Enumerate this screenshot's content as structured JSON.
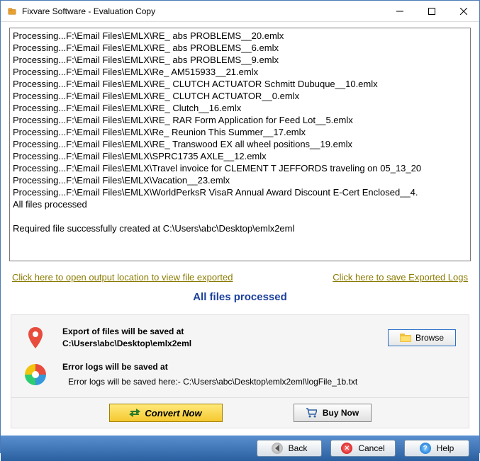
{
  "window": {
    "title": "Fixvare Software - Evaluation Copy"
  },
  "log": {
    "lines": [
      "Processing...F:\\Email Files\\EMLX\\RE_ abs PROBLEMS__20.emlx",
      "Processing...F:\\Email Files\\EMLX\\RE_ abs PROBLEMS__6.emlx",
      "Processing...F:\\Email Files\\EMLX\\RE_ abs PROBLEMS__9.emlx",
      "Processing...F:\\Email Files\\EMLX\\Re_ AM515933__21.emlx",
      "Processing...F:\\Email Files\\EMLX\\RE_ CLUTCH ACTUATOR Schmitt Dubuque__10.emlx",
      "Processing...F:\\Email Files\\EMLX\\RE_ CLUTCH ACTUATOR__0.emlx",
      "Processing...F:\\Email Files\\EMLX\\RE_ Clutch__16.emlx",
      "Processing...F:\\Email Files\\EMLX\\RE_ RAR Form Application for Feed Lot__5.emlx",
      "Processing...F:\\Email Files\\EMLX\\Re_ Reunion This Summer__17.emlx",
      "Processing...F:\\Email Files\\EMLX\\RE_ Transwood EX all wheel positions__19.emlx",
      "Processing...F:\\Email Files\\EMLX\\SPRC1735 AXLE__12.emlx",
      "Processing...F:\\Email Files\\EMLX\\Travel invoice for CLEMENT T JEFFORDS traveling on 05_13_20",
      "Processing...F:\\Email Files\\EMLX\\Vacation__23.emlx",
      "Processing...F:\\Email Files\\EMLX\\WorldPerksR VisaR Annual Award Discount E-Cert Enclosed__4.",
      "All files processed",
      "",
      "Required file successfully created at C:\\Users\\abc\\Desktop\\emlx2eml"
    ]
  },
  "links": {
    "open_output": "Click here to open output location to view file exported",
    "save_logs": "Click here to save Exported Logs"
  },
  "status": "All files processed",
  "panel": {
    "export_label": "Export of files will be saved at",
    "export_path": "C:\\Users\\abc\\Desktop\\emlx2eml",
    "browse": "Browse",
    "error_label": "Error logs will be saved at",
    "error_path": "Error logs will be saved here:- C:\\Users\\abc\\Desktop\\emlx2eml\\logFile_1b.txt"
  },
  "actions": {
    "convert": "Convert Now",
    "buy": "Buy Now"
  },
  "footer": {
    "back": "Back",
    "cancel": "Cancel",
    "help": "Help"
  }
}
